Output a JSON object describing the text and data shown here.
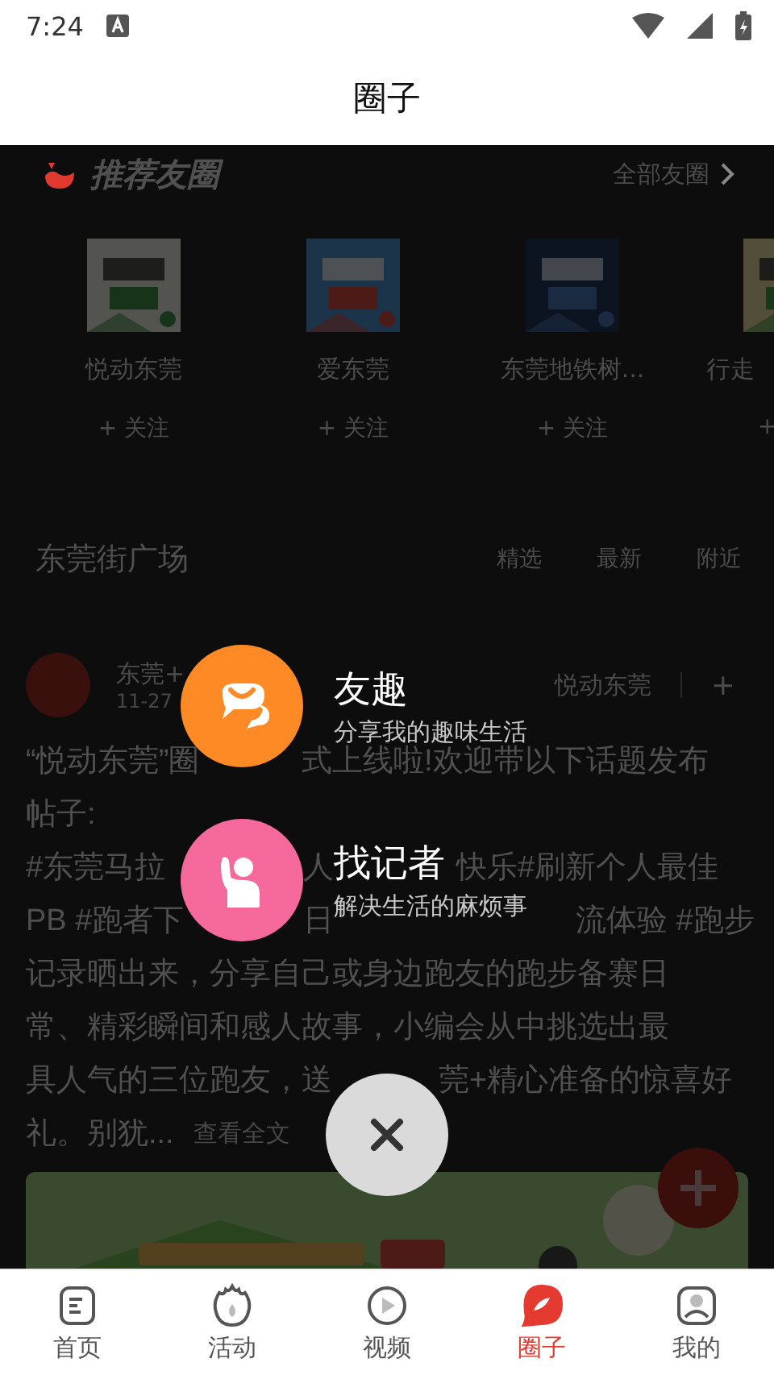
{
  "status_bar": {
    "time": "7:24"
  },
  "header": {
    "title": "圈子"
  },
  "recommended": {
    "title": "推荐友圈",
    "all_link": "全部友圈"
  },
  "circles": [
    {
      "name": "悦动东莞",
      "follow": "+ 关注",
      "kind": "green"
    },
    {
      "name": "爱东莞",
      "follow": "+ 关注",
      "kind": "blue"
    },
    {
      "name": "东莞地铁树...",
      "follow": "+ 关注",
      "kind": "navy"
    },
    {
      "name": "行走",
      "follow": "+",
      "kind": "yellow"
    }
  ],
  "plaza": {
    "title": "东莞街广场",
    "tabs": [
      "精选",
      "最新",
      "附近"
    ]
  },
  "post": {
    "author": "东莞+",
    "date": "11-27",
    "circle": "悦动东莞",
    "follow": "+",
    "lines": [
      [
        "“悦动东莞”圈",
        "式上线啦!欢迎带以下话题发布"
      ],
      [
        "帖子:"
      ],
      [
        "#东莞马拉",
        "人",
        "快乐#刷新个人最佳"
      ],
      [
        "PB #跑者下",
        "日",
        "流体验 #跑步"
      ],
      [
        "记录晒出来，分享自己或身边跑友的跑步备赛日"
      ],
      [
        "常、精彩瞬间和感人故事，小编会从中挑选出最"
      ],
      [
        "具人气的三位跑友，送",
        "莞+精心准备的惊喜好"
      ],
      [
        "礼。别犹..."
      ]
    ],
    "more": "查看全文"
  },
  "menu": {
    "items": [
      {
        "kind": "chat",
        "title": "友趣",
        "subtitle": "分享我的趣味生活",
        "color": "#fd8a24"
      },
      {
        "kind": "person",
        "title": "找记者",
        "subtitle": "解决生活的麻烦事",
        "color": "#f5699c"
      }
    ]
  },
  "nav": [
    {
      "kind": "doc",
      "label": "首页",
      "selected": false
    },
    {
      "kind": "flame",
      "label": "活动",
      "selected": false
    },
    {
      "kind": "play",
      "label": "视频",
      "selected": false
    },
    {
      "kind": "circle",
      "label": "圈子",
      "selected": true
    },
    {
      "kind": "user",
      "label": "我的",
      "selected": false
    }
  ]
}
